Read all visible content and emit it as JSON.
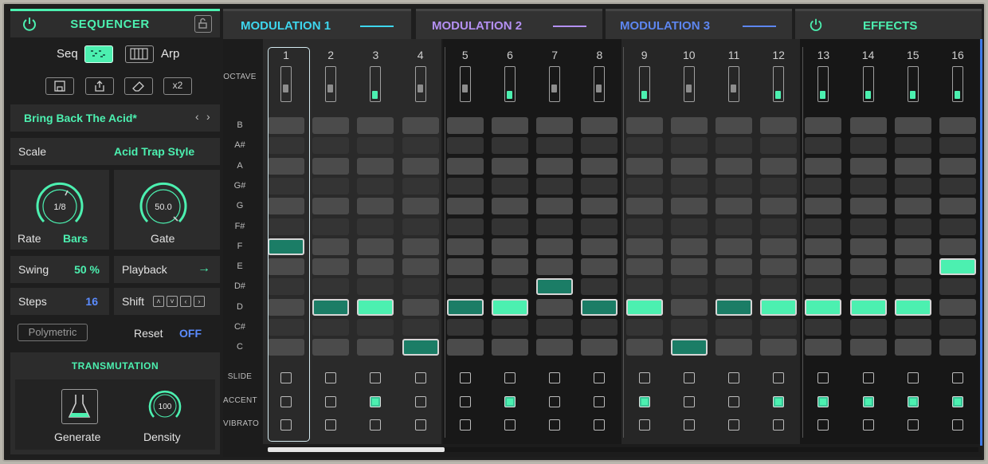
{
  "sequencer": {
    "title": "SEQUENCER",
    "seq_label": "Seq",
    "arp_label": "Arp",
    "x2_label": "x2",
    "preset_name": "Bring Back The Acid*",
    "preset_prev": "‹",
    "preset_next": "›",
    "scale_label": "Scale",
    "scale_value": "Acid Trap Style",
    "rate_label": "Rate",
    "rate_value": "1/8",
    "rate_unit": "Bars",
    "gate_label": "Gate",
    "gate_value": "50.0",
    "swing_label": "Swing",
    "swing_value": "50 %",
    "playback_label": "Playback",
    "playback_value": "→",
    "steps_label": "Steps",
    "steps_value": "16",
    "shift_label": "Shift",
    "polymetric_label": "Polymetric",
    "reset_label": "Reset",
    "reset_value": "OFF",
    "transmutation_title": "TRANSMUTATION",
    "generate_label": "Generate",
    "density_label": "Density",
    "density_value": "100"
  },
  "tabs": [
    {
      "label": "MODULATION 1",
      "color": "#3ed6ee"
    },
    {
      "label": "MODULATION 2",
      "color": "#b490f2"
    },
    {
      "label": "MODULATION 3",
      "color": "#5d86f0"
    },
    {
      "label": "EFFECTS",
      "color": "#4cf0b0"
    }
  ],
  "grid": {
    "octave_label": "OCTAVE",
    "notes": [
      "B",
      "A#",
      "A",
      "G#",
      "G",
      "F#",
      "F",
      "E",
      "D#",
      "D",
      "C#",
      "C"
    ],
    "bottom_rows": [
      "SLIDE",
      "ACCENT",
      "VIBRATO"
    ],
    "steps": [
      {
        "num": "1",
        "note": "F",
        "octave_up": false,
        "accent": false
      },
      {
        "num": "2",
        "note": "D",
        "octave_up": false,
        "accent": false
      },
      {
        "num": "3",
        "note": "D",
        "octave_up": true,
        "accent": true
      },
      {
        "num": "4",
        "note": "C",
        "octave_up": false,
        "accent": false
      },
      {
        "num": "5",
        "note": "D",
        "octave_up": false,
        "accent": false
      },
      {
        "num": "6",
        "note": "D",
        "octave_up": true,
        "accent": true
      },
      {
        "num": "7",
        "note": "D#",
        "octave_up": false,
        "accent": false
      },
      {
        "num": "8",
        "note": "D",
        "octave_up": false,
        "accent": false
      },
      {
        "num": "9",
        "note": "D",
        "octave_up": true,
        "accent": true
      },
      {
        "num": "10",
        "note": "C",
        "octave_up": false,
        "accent": false
      },
      {
        "num": "11",
        "note": "D",
        "octave_up": false,
        "accent": false
      },
      {
        "num": "12",
        "note": "D",
        "octave_up": true,
        "accent": true
      },
      {
        "num": "13",
        "note": "D",
        "octave_up": true,
        "accent": true
      },
      {
        "num": "14",
        "note": "D",
        "octave_up": true,
        "accent": true
      },
      {
        "num": "15",
        "note": "D",
        "octave_up": true,
        "accent": true
      },
      {
        "num": "16",
        "note": "E",
        "octave_up": true,
        "accent": true
      }
    ]
  },
  "colors": {
    "accent_green": "#4cf0b0",
    "accent_blue": "#5b8cff",
    "active_dark": "#1b7d66"
  }
}
